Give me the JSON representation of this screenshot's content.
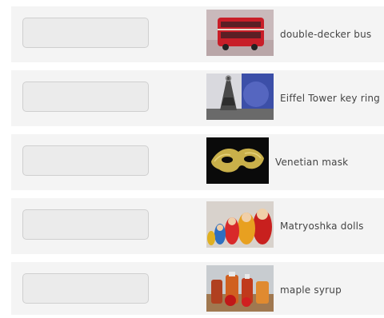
{
  "items": [
    {
      "label": "double-decker bus",
      "image_icon": "red-double-decker-bus"
    },
    {
      "label": "Eiffel Tower key ring",
      "image_icon": "eiffel-tower-key-ring"
    },
    {
      "label": "Venetian mask",
      "image_icon": "gold-venetian-mask"
    },
    {
      "label": "Matryoshka dolls",
      "image_icon": "matryoshka-dolls"
    },
    {
      "label": "maple syrup",
      "image_icon": "maple-syrup-bottles"
    }
  ]
}
